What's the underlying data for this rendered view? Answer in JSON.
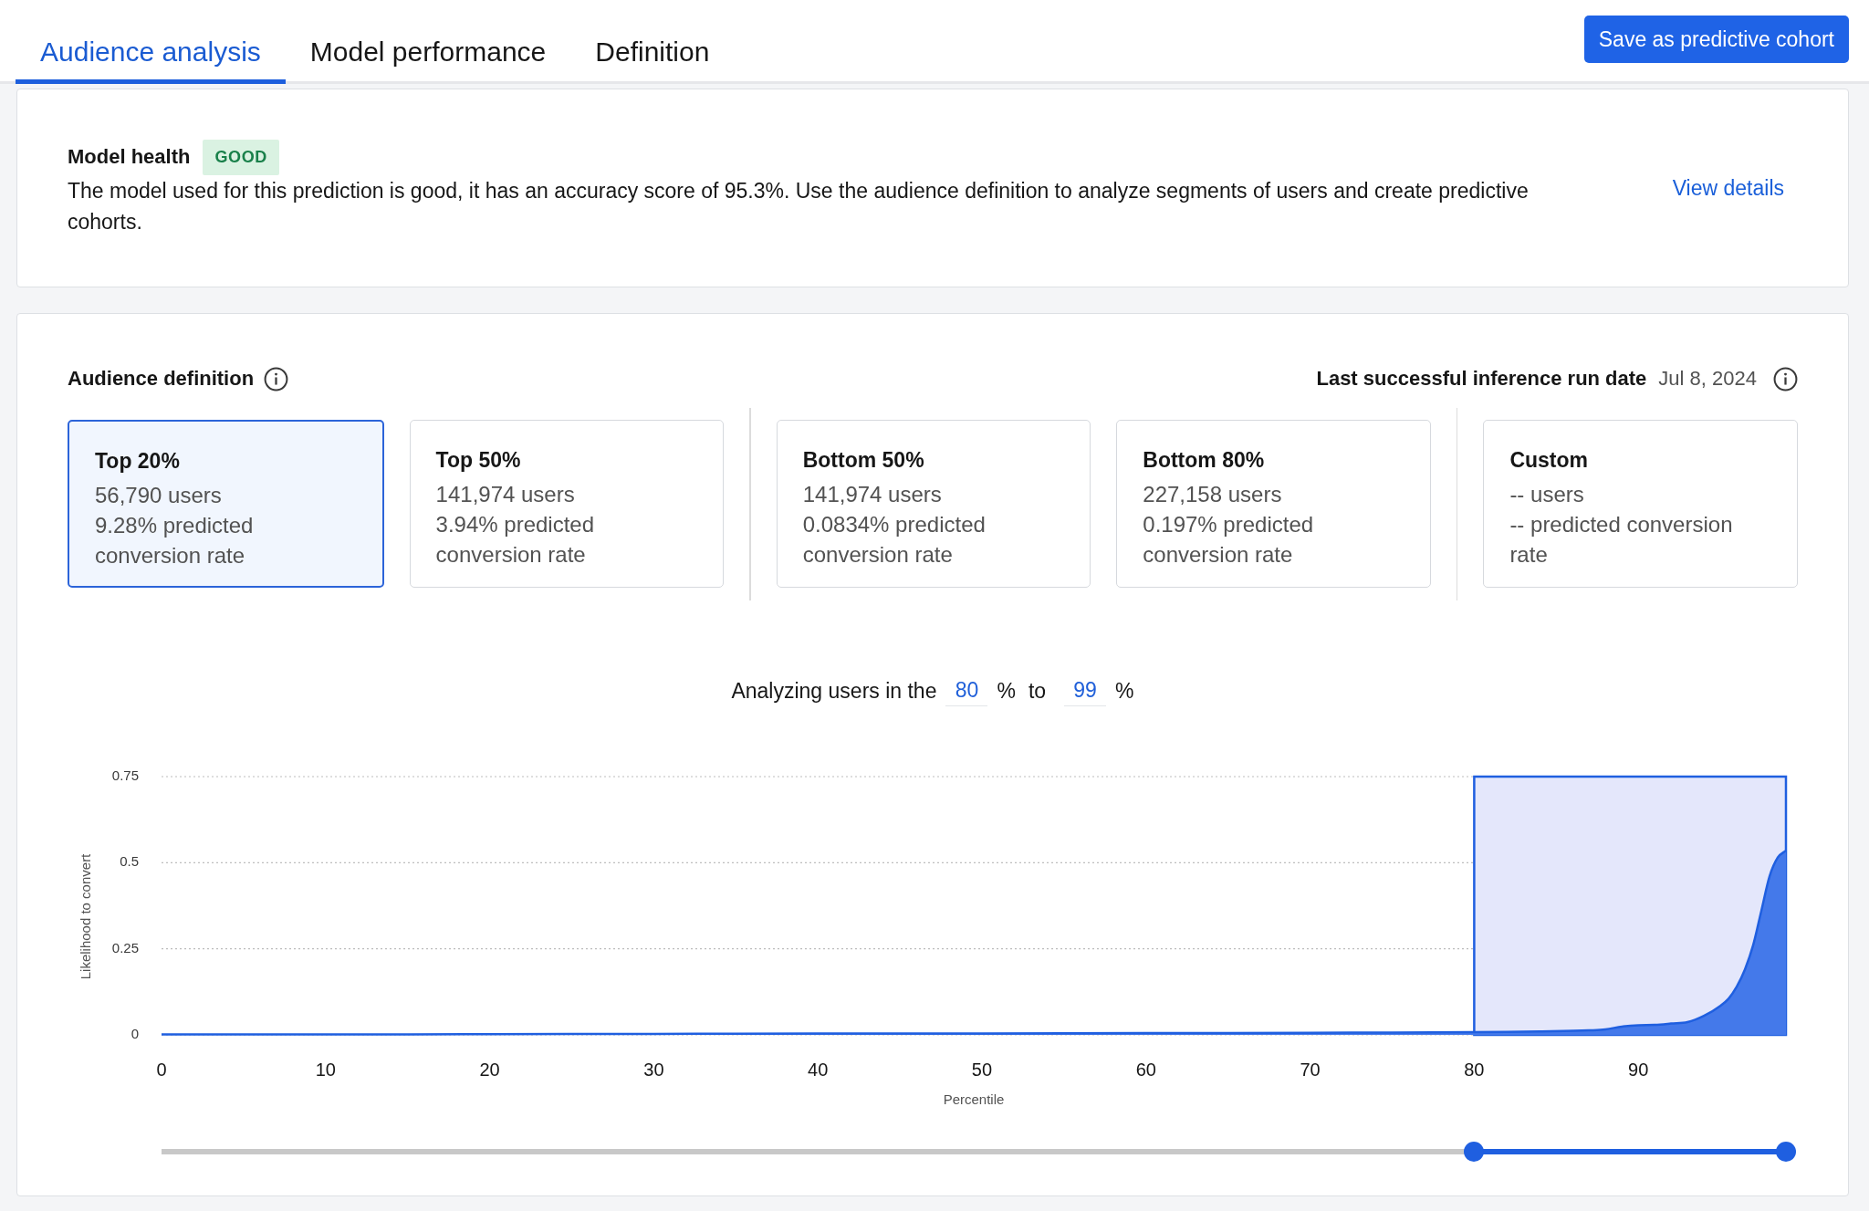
{
  "tabs": [
    {
      "label": "Audience analysis",
      "selected": true
    },
    {
      "label": "Model performance",
      "selected": false
    },
    {
      "label": "Definition",
      "selected": false
    }
  ],
  "save_button": {
    "label": "Save as predictive cohort"
  },
  "model_health": {
    "title": "Model health",
    "status": "GOOD",
    "description": "The model used for this prediction is good, it has an accuracy score of 95.3%. Use the audience definition to analyze segments of users and create predictive cohorts.",
    "link": "View details"
  },
  "audience_definition": {
    "title": "Audience definition",
    "last_run_label": "Last successful inference run date",
    "last_run_date": "Jul 8, 2024",
    "segment_groups": [
      {
        "segments": [
          {
            "name": "Top 20%",
            "users": "56,790 users",
            "conversion": "9.28% predicted conversion rate",
            "selected": true
          },
          {
            "name": "Top 50%",
            "users": "141,974 users",
            "conversion": "3.94% predicted conversion rate",
            "selected": false
          }
        ]
      },
      {
        "segments": [
          {
            "name": "Bottom 50%",
            "users": "141,974 users",
            "conversion": "0.0834% predicted conversion rate",
            "selected": false
          },
          {
            "name": "Bottom 80%",
            "users": "227,158 users",
            "conversion": "0.197% predicted conversion rate",
            "selected": false
          }
        ]
      },
      {
        "segments": [
          {
            "name": "Custom",
            "users": "-- users",
            "conversion": "-- predicted conversion rate",
            "selected": false
          }
        ]
      }
    ]
  },
  "range_filter": {
    "label": "Analyzing users in the",
    "from": "80",
    "from_unit": "%",
    "separator": "to",
    "to": "99",
    "to_unit": "%"
  },
  "chart_data": {
    "type": "area",
    "xlabel": "Percentile",
    "ylabel": "Likelihood to convert",
    "x": [
      0,
      10,
      20,
      30,
      40,
      50,
      60,
      70,
      75,
      80,
      84,
      87,
      88,
      89,
      90,
      91,
      92,
      93,
      94,
      95,
      95.5,
      96,
      96.5,
      97,
      97.5,
      98,
      98.5,
      99
    ],
    "values": [
      0.001,
      0.001,
      0.002,
      0.003,
      0.004,
      0.004,
      0.005,
      0.006,
      0.007,
      0.008,
      0.01,
      0.013,
      0.016,
      0.024,
      0.028,
      0.029,
      0.033,
      0.037,
      0.055,
      0.084,
      0.105,
      0.14,
      0.19,
      0.26,
      0.36,
      0.46,
      0.515,
      0.535
    ],
    "xlim": [
      0,
      99
    ],
    "ylim": [
      0,
      0.75
    ],
    "xticks": [
      0,
      10,
      20,
      30,
      40,
      50,
      60,
      70,
      80,
      90
    ],
    "yticks": [
      0,
      0.25,
      0.5,
      0.75
    ],
    "bands": [
      {
        "axis": "x",
        "from": 80,
        "to": 99
      }
    ]
  },
  "range_slider": {
    "thumbs": [
      {
        "level": 0.808
      },
      {
        "level": 1
      }
    ]
  }
}
